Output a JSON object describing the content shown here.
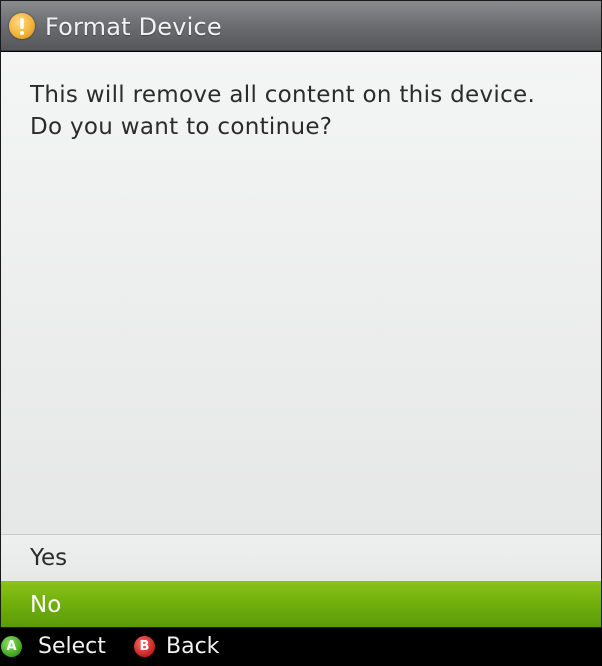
{
  "dialog": {
    "title": "Format Device",
    "icon": "warning-icon",
    "message_line1": "This will remove all content on this device.",
    "message_line2": "Do you want to continue?"
  },
  "options": [
    {
      "label": "Yes",
      "selected": false
    },
    {
      "label": "No",
      "selected": true
    }
  ],
  "footer": {
    "hints": [
      {
        "button": "A",
        "label": "Select"
      },
      {
        "button": "B",
        "label": "Back"
      }
    ]
  },
  "colors": {
    "accent_green": "#6fae0b",
    "titlebar": "#6d6f72",
    "button_a": "#3ea11a",
    "button_b": "#c81e1e",
    "warning": "#f3b43a"
  }
}
